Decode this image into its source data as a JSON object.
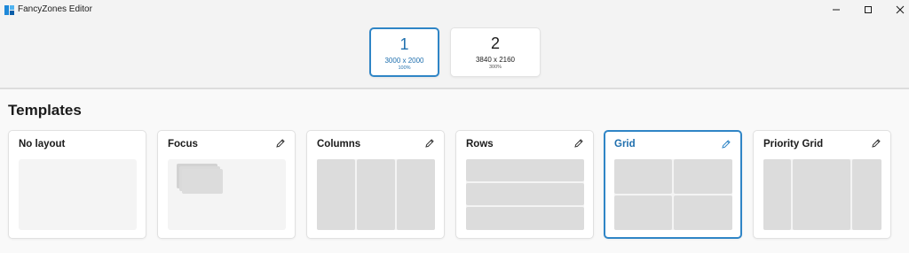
{
  "window": {
    "title": "FancyZones Editor",
    "controls": [
      "minimize-icon",
      "maximize-icon",
      "close-icon"
    ]
  },
  "monitors": [
    {
      "number": "1",
      "resolution": "3000 x 2000",
      "scale": "100%",
      "selected": true
    },
    {
      "number": "2",
      "resolution": "3840 x 2160",
      "scale": "300%",
      "selected": false
    }
  ],
  "templates": {
    "title": "Templates",
    "items": [
      {
        "name": "No layout",
        "editable": false,
        "selected": false
      },
      {
        "name": "Focus",
        "editable": true,
        "selected": false
      },
      {
        "name": "Columns",
        "editable": true,
        "selected": false
      },
      {
        "name": "Rows",
        "editable": true,
        "selected": false
      },
      {
        "name": "Grid",
        "editable": true,
        "selected": true
      },
      {
        "name": "Priority Grid",
        "editable": true,
        "selected": false
      }
    ]
  },
  "colors": {
    "accent": "#2f85c6",
    "zone": "#dcdcdc",
    "preview_bg": "#f4f4f4"
  }
}
